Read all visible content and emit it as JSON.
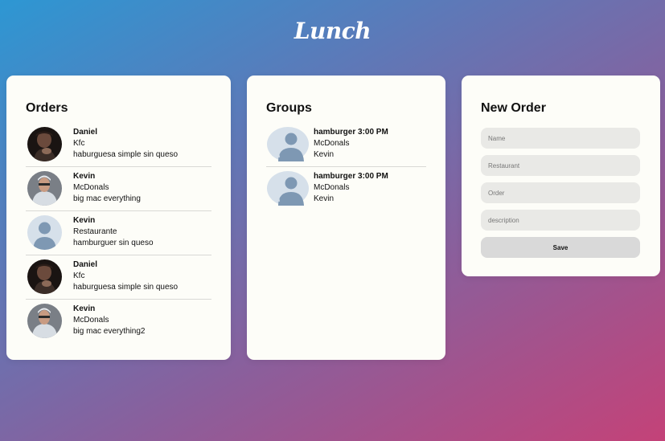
{
  "app": {
    "title": "Lunch"
  },
  "orders": {
    "title": "Orders",
    "items": [
      {
        "name": "Daniel",
        "restaurant": "Kfc",
        "description": "haburguesa simple sin queso",
        "avatar": "photo-daniel"
      },
      {
        "name": "Kevin",
        "restaurant": "McDonals",
        "description": "big mac everything",
        "avatar": "photo-kevin"
      },
      {
        "name": "Kevin",
        "restaurant": "Restaurante",
        "description": "hamburguer sin queso",
        "avatar": "default-user-icon"
      },
      {
        "name": "Daniel",
        "restaurant": "Kfc",
        "description": "haburguesa simple sin queso",
        "avatar": "photo-daniel"
      },
      {
        "name": "Kevin",
        "restaurant": "McDonals",
        "description": "big mac everything2",
        "avatar": "photo-kevin"
      }
    ]
  },
  "groups": {
    "title": "Groups",
    "items": [
      {
        "title": "hamburger 3:00 PM",
        "restaurant": "McDonals",
        "owner": "Kevin",
        "avatar": "default-group-icon"
      },
      {
        "title": "hamburger 3:00 PM",
        "restaurant": "McDonals",
        "owner": "Kevin",
        "avatar": "default-group-icon"
      }
    ]
  },
  "new_order": {
    "title": "New Order",
    "fields": {
      "name": {
        "placeholder": "Name",
        "value": ""
      },
      "restaurant": {
        "placeholder": "Restaurant",
        "value": ""
      },
      "order": {
        "placeholder": "Order",
        "value": ""
      },
      "description": {
        "placeholder": "description",
        "value": ""
      }
    },
    "save_label": "Save"
  },
  "colors": {
    "gradient_start": "#2d97d3",
    "gradient_end": "#c44278",
    "card_background": "#fdfdf8",
    "input_background": "#e9e9e6",
    "button_background": "#d9d9d9",
    "avatar_placeholder": "#7e98b3"
  }
}
